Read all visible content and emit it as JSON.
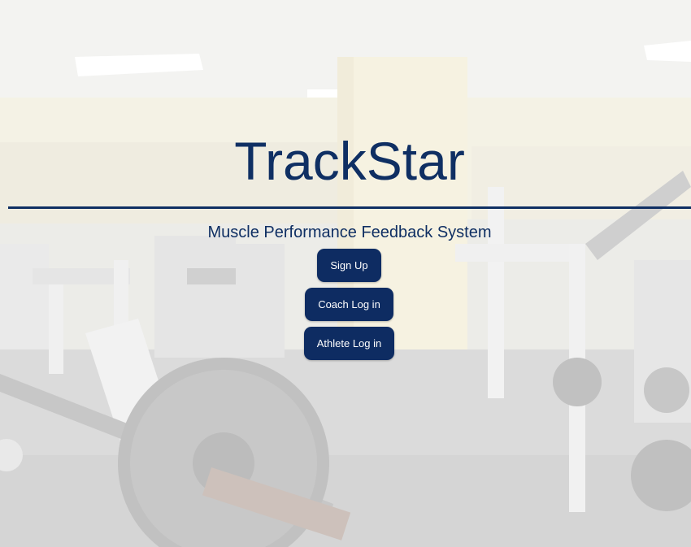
{
  "app": {
    "title": "TrackStar",
    "subtitle": "Muscle Performance Feedback System"
  },
  "buttons": {
    "sign_up": "Sign Up",
    "coach_login": "Coach Log in",
    "athlete_login": "Athlete Log in"
  },
  "colors": {
    "brand_navy": "#0f2f63",
    "button_bg": "#0e2c62",
    "button_text": "#ffffff"
  },
  "background": {
    "icon": "gym-photo"
  }
}
